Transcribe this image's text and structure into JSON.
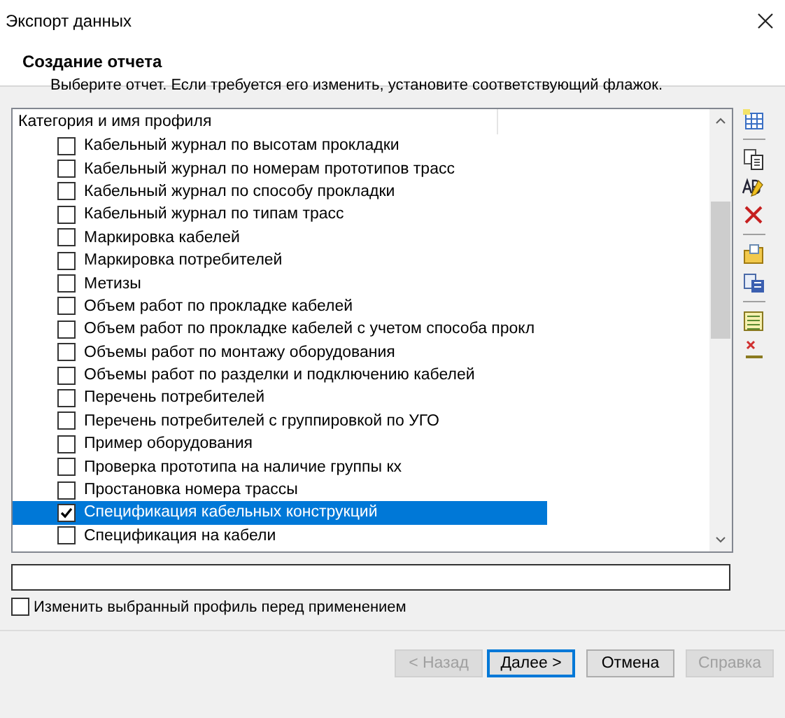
{
  "window": {
    "title": "Экспорт данных"
  },
  "header": {
    "title": "Создание отчета",
    "subtitle": "Выберите отчет. Если требуется его изменить, установите соответствующий флажок."
  },
  "list": {
    "column": "Категория и имя профиля",
    "items": [
      {
        "label": "Кабельный журнал по высотам прокладки",
        "checked": false,
        "selected": false
      },
      {
        "label": "Кабельный журнал по номерам прототипов трасс",
        "checked": false,
        "selected": false
      },
      {
        "label": "Кабельный журнал по способу прокладки",
        "checked": false,
        "selected": false
      },
      {
        "label": "Кабельный журнал по типам трасс",
        "checked": false,
        "selected": false
      },
      {
        "label": "Маркировка кабелей",
        "checked": false,
        "selected": false
      },
      {
        "label": "Маркировка потребителей",
        "checked": false,
        "selected": false
      },
      {
        "label": "Метизы",
        "checked": false,
        "selected": false
      },
      {
        "label": "Объем работ по прокладке кабелей",
        "checked": false,
        "selected": false
      },
      {
        "label": "Объем работ по прокладке кабелей с учетом способа прокл",
        "checked": false,
        "selected": false
      },
      {
        "label": "Объемы работ по монтажу оборудования",
        "checked": false,
        "selected": false
      },
      {
        "label": "Объемы работ по разделки и подключению кабелей",
        "checked": false,
        "selected": false
      },
      {
        "label": "Перечень потребителей",
        "checked": false,
        "selected": false
      },
      {
        "label": "Перечень потребителей с группировкой по УГО",
        "checked": false,
        "selected": false
      },
      {
        "label": "Пример оборудования",
        "checked": false,
        "selected": false
      },
      {
        "label": "Проверка прототипа на наличие группы кх",
        "checked": false,
        "selected": false
      },
      {
        "label": "Простановка номера трассы",
        "checked": false,
        "selected": false
      },
      {
        "label": "Спецификация кабельных конструкций",
        "checked": true,
        "selected": true
      },
      {
        "label": "Спецификация на кабели",
        "checked": false,
        "selected": false
      }
    ]
  },
  "edit_option": {
    "label": "Изменить выбранный профиль перед применением",
    "checked": false
  },
  "buttons": [
    {
      "label": "< Назад",
      "disabled": true,
      "default": false
    },
    {
      "label": "Далее >",
      "disabled": false,
      "default": true
    },
    {
      "label": "Отмена",
      "disabled": false,
      "default": false
    },
    {
      "label": "Справка",
      "disabled": true,
      "default": false
    }
  ]
}
